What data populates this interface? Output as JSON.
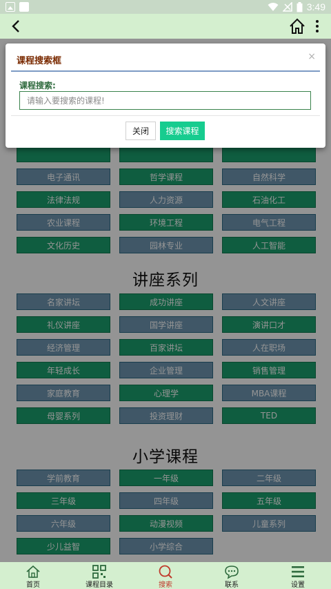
{
  "status_bar": {
    "time": "3:49"
  },
  "nav": {
    "back_icon": "back-arrow-icon",
    "home_icon": "home-icon",
    "more_icon": "more-vertical-icon"
  },
  "course_grid_top": [
    {
      "label": "",
      "color": "green"
    },
    {
      "label": "",
      "color": "green"
    },
    {
      "label": "",
      "color": "green"
    },
    {
      "label": "电子通讯",
      "color": "blue"
    },
    {
      "label": "哲学课程",
      "color": "green"
    },
    {
      "label": "自然科学",
      "color": "blue"
    },
    {
      "label": "法律法规",
      "color": "green"
    },
    {
      "label": "人力资源",
      "color": "blue"
    },
    {
      "label": "石油化工",
      "color": "green"
    },
    {
      "label": "农业课程",
      "color": "blue"
    },
    {
      "label": "环境工程",
      "color": "green"
    },
    {
      "label": "电气工程",
      "color": "blue"
    },
    {
      "label": "文化历史",
      "color": "green"
    },
    {
      "label": "园林专业",
      "color": "blue"
    },
    {
      "label": "人工智能",
      "color": "green"
    }
  ],
  "lecture_section": {
    "title": "讲座系列",
    "items": [
      {
        "label": "名家讲坛",
        "color": "blue"
      },
      {
        "label": "成功讲座",
        "color": "green"
      },
      {
        "label": "人文讲座",
        "color": "blue"
      },
      {
        "label": "礼仪讲座",
        "color": "green"
      },
      {
        "label": "国学讲座",
        "color": "blue"
      },
      {
        "label": "演讲口才",
        "color": "green"
      },
      {
        "label": "经济管理",
        "color": "blue"
      },
      {
        "label": "百家讲坛",
        "color": "green"
      },
      {
        "label": "人在职场",
        "color": "blue"
      },
      {
        "label": "年轻成长",
        "color": "green"
      },
      {
        "label": "企业管理",
        "color": "blue"
      },
      {
        "label": "销售管理",
        "color": "green"
      },
      {
        "label": "家庭教育",
        "color": "blue"
      },
      {
        "label": "心理学",
        "color": "green"
      },
      {
        "label": "MBA课程",
        "color": "blue"
      },
      {
        "label": "母婴系列",
        "color": "green"
      },
      {
        "label": "投资理财",
        "color": "blue"
      },
      {
        "label": "TED",
        "color": "green"
      }
    ]
  },
  "primary_section": {
    "title": "小学课程",
    "items": [
      {
        "label": "学前教育",
        "color": "blue"
      },
      {
        "label": "一年级",
        "color": "green"
      },
      {
        "label": "二年级",
        "color": "blue"
      },
      {
        "label": "三年级",
        "color": "green"
      },
      {
        "label": "四年级",
        "color": "blue"
      },
      {
        "label": "五年级",
        "color": "green"
      },
      {
        "label": "六年级",
        "color": "blue"
      },
      {
        "label": "动漫视频",
        "color": "green"
      },
      {
        "label": "儿童系列",
        "color": "blue"
      },
      {
        "label": "少儿益智",
        "color": "green"
      },
      {
        "label": "小学综合",
        "color": "blue"
      }
    ]
  },
  "modal": {
    "title": "课程搜索框",
    "close_symbol": "×",
    "field_label": "课程搜索:",
    "input_value": "",
    "input_placeholder": "请输入要搜索的课程!",
    "cancel_label": "关闭",
    "search_label": "搜索课程"
  },
  "tabbar": {
    "items": [
      {
        "label": "首页",
        "icon": "home-icon",
        "active": false
      },
      {
        "label": "课程目录",
        "icon": "qr-grid-icon",
        "active": false
      },
      {
        "label": "搜索",
        "icon": "search-icon",
        "active": true
      },
      {
        "label": "联系",
        "icon": "chat-bubble-icon",
        "active": false
      },
      {
        "label": "设置",
        "icon": "menu-icon",
        "active": false
      }
    ]
  },
  "colors": {
    "grid_blue": "#6e97b2",
    "grid_green": "#1aa06e",
    "accent": "#17cc8f",
    "nav_bg": "#d4efcf"
  }
}
